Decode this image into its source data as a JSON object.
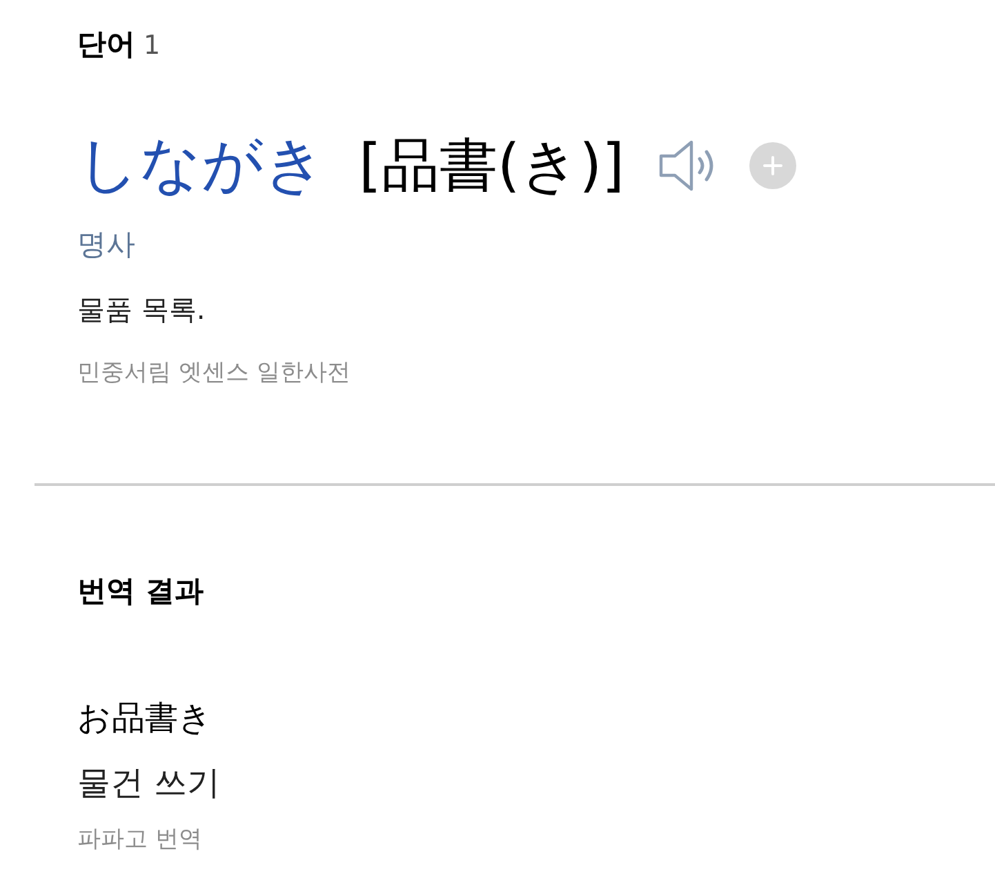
{
  "word_section": {
    "heading": "단어",
    "count": "1",
    "entries": [
      {
        "headword": "しながき",
        "kanji": "[品書(き)]",
        "part_of_speech": "명사",
        "meaning": "물품 목록.",
        "source": "민중서림 엣센스 일한사전"
      }
    ]
  },
  "translation_section": {
    "heading": "번역 결과",
    "original": "お品書き",
    "translation": "물건 쓰기",
    "source": "파파고 번역"
  }
}
